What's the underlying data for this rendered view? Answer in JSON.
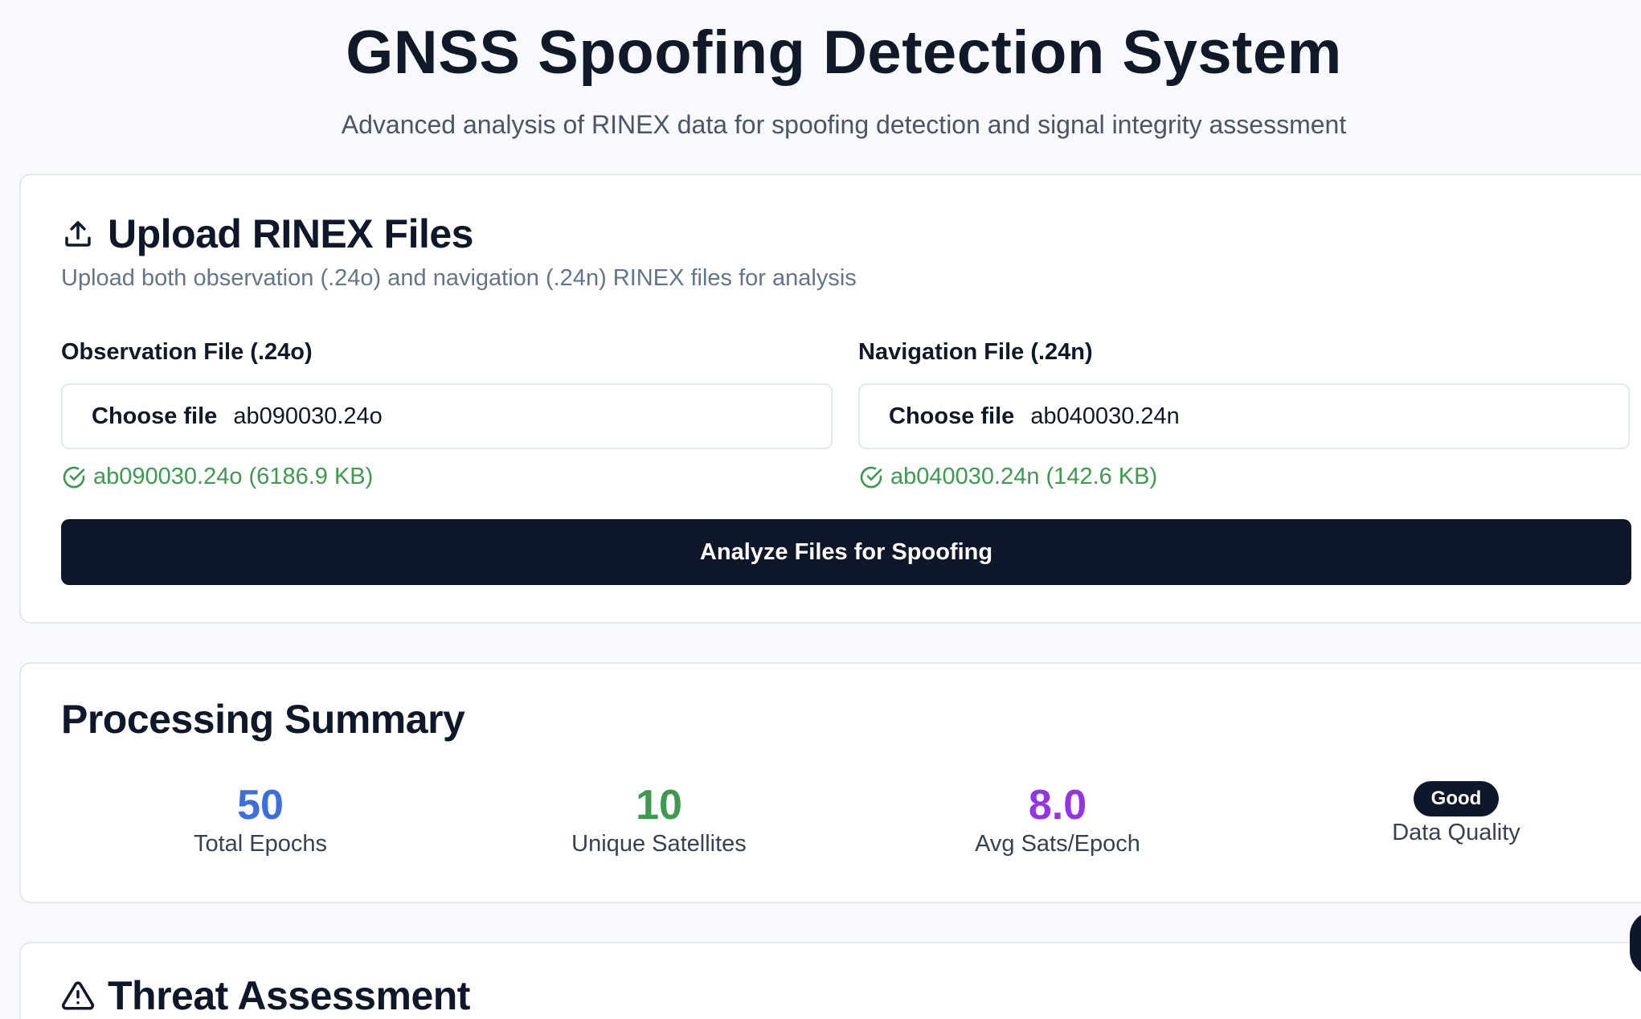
{
  "header": {
    "title": "GNSS Spoofing Detection System",
    "subtitle": "Advanced analysis of RINEX data for spoofing detection and signal integrity assessment"
  },
  "upload": {
    "title": "Upload RINEX Files",
    "icon": "upload-icon",
    "description": "Upload both observation (.24o) and navigation (.24n) RINEX files for analysis",
    "observation": {
      "label": "Observation File (.24o)",
      "button_label": "Choose file",
      "file_name": "ab090030.24o",
      "status": "ab090030.24o (6186.9 KB)"
    },
    "navigation": {
      "label": "Navigation File (.24n)",
      "button_label": "Choose file",
      "file_name": "ab040030.24n",
      "status": "ab040030.24n (142.6 KB)"
    },
    "status_icon": "check-circle-icon",
    "status_color": "#3d9a4f",
    "analyze_label": "Analyze Files for Spoofing"
  },
  "summary": {
    "title": "Processing Summary",
    "stats": [
      {
        "value": "50",
        "label": "Total Epochs",
        "color": "#3b6fe0"
      },
      {
        "value": "10",
        "label": "Unique Satellites",
        "color": "#3d9a4f"
      },
      {
        "value": "8.0",
        "label": "Avg Sats/Epoch",
        "color": "#9333ea"
      }
    ],
    "quality": {
      "badge": "Good",
      "label": "Data Quality"
    }
  },
  "threat": {
    "title": "Threat Assessment",
    "icon": "warning-triangle-icon"
  }
}
